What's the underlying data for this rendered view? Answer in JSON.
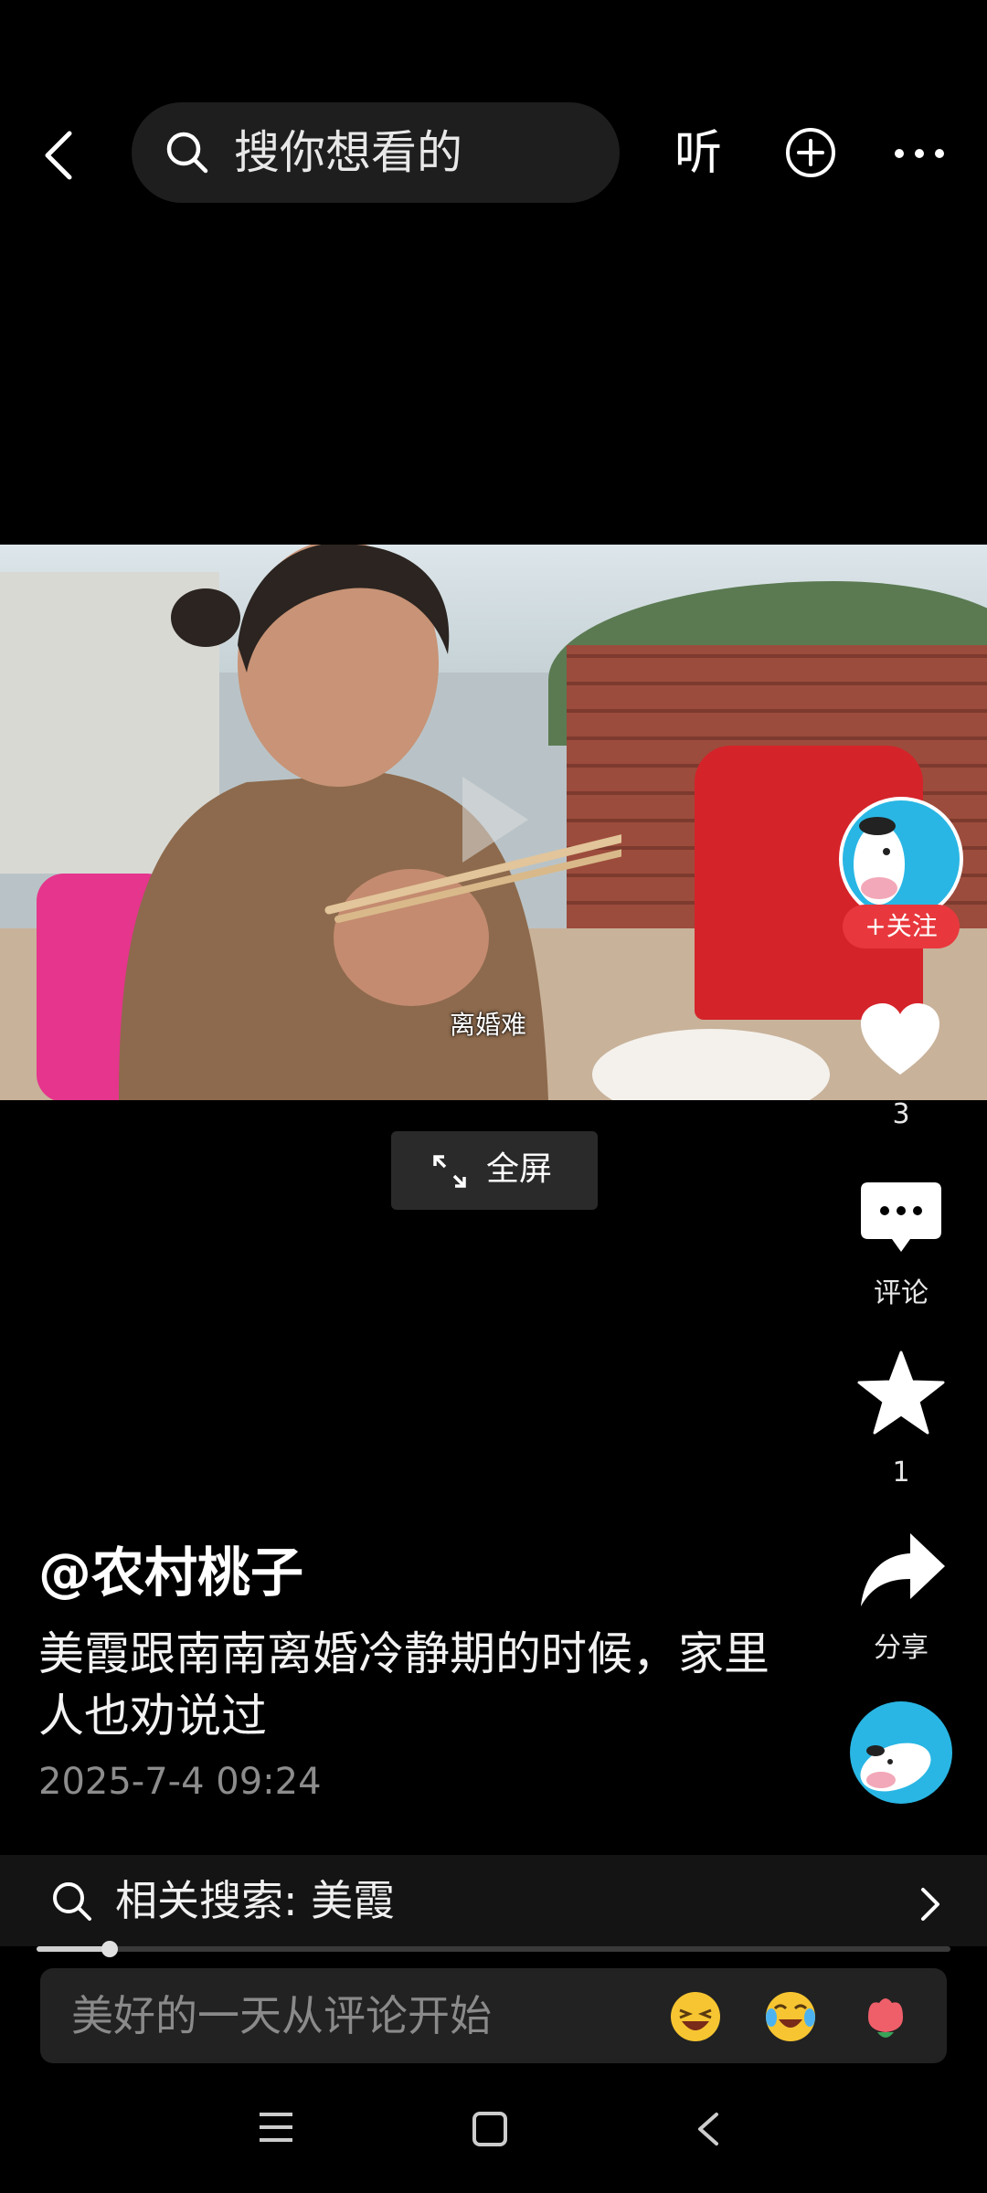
{
  "top_bar": {
    "search_placeholder": "搜你想看的",
    "listen_label": "听"
  },
  "video": {
    "caption": "离婚难",
    "fullscreen_label": "全屏"
  },
  "rail": {
    "follow_label": "+关注",
    "like_count": "3",
    "comment_label": "评论",
    "favorite_count": "1",
    "share_label": "分享"
  },
  "post": {
    "author": "@农村桃子",
    "description": "美霞跟南南离婚冷静期的时候，家里人也劝说过",
    "date": "2025-7-4 09:24"
  },
  "related_search": {
    "label": "相关搜索: 美霞"
  },
  "playback": {
    "progress_fraction": 0.08
  },
  "comment_bar": {
    "placeholder": "美好的一天从评论开始",
    "emojis": [
      "laughing-emoji",
      "crying-laughing-emoji",
      "flower-emoji"
    ]
  },
  "nav": {
    "icons": [
      "menu-icon",
      "home-square-icon",
      "back-icon"
    ]
  },
  "colors": {
    "background": "#000000",
    "follow_red": "#e8383d",
    "avatar_blue": "#29b6e4"
  }
}
